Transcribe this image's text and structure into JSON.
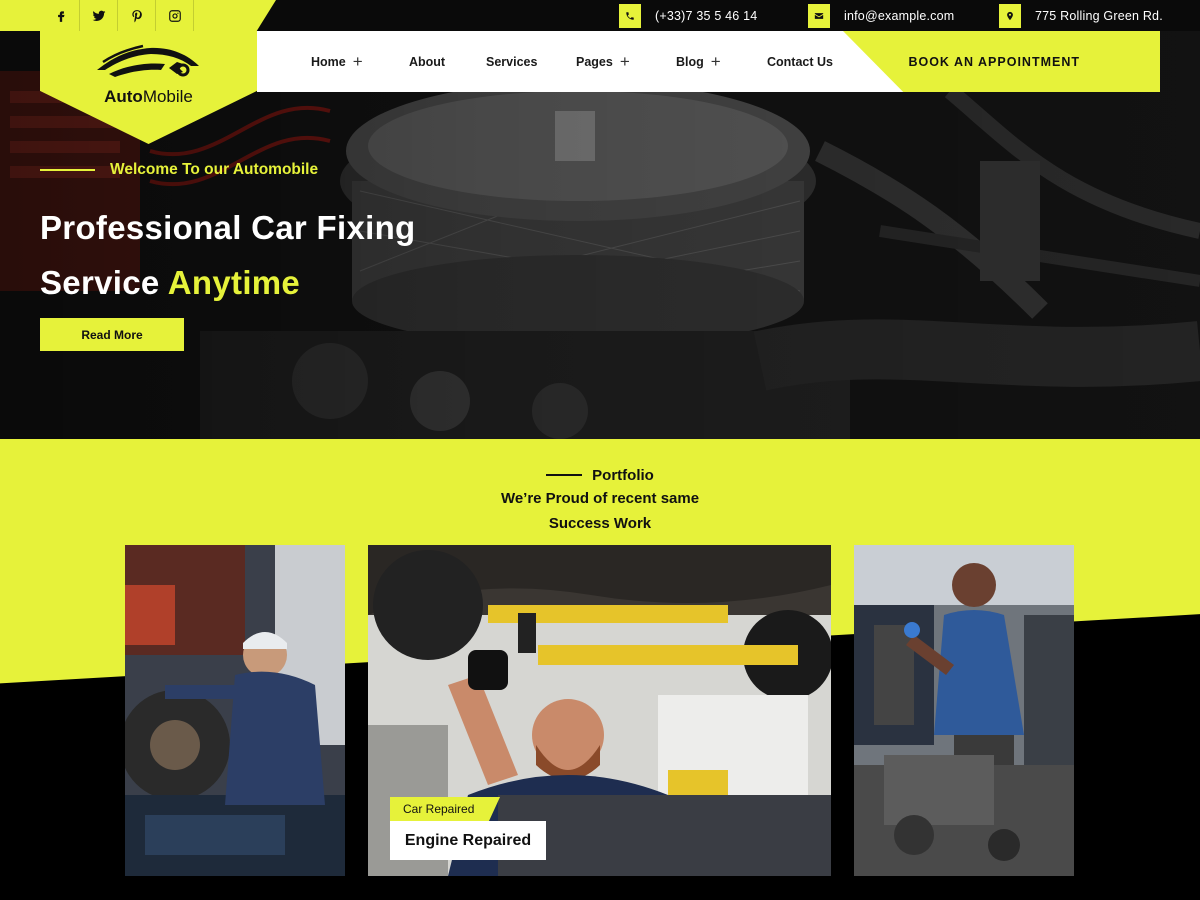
{
  "topbar": {
    "socials": [
      {
        "icon": "facebook-icon"
      },
      {
        "icon": "twitter-icon"
      },
      {
        "icon": "pinterest-icon"
      },
      {
        "icon": "instagram-icon"
      }
    ],
    "phone": "(+33)7 35 5 46 14",
    "email": "info@example.com",
    "address": "775 Rolling Green Rd."
  },
  "logo": {
    "bold": "Auto",
    "rest": "Mobile"
  },
  "nav": {
    "items": [
      {
        "label": "Home",
        "has_submenu": true
      },
      {
        "label": "About",
        "has_submenu": false
      },
      {
        "label": "Services",
        "has_submenu": false
      },
      {
        "label": "Pages",
        "has_submenu": true
      },
      {
        "label": "Blog",
        "has_submenu": true
      },
      {
        "label": "Contact Us",
        "has_submenu": false
      }
    ],
    "cta": "BOOK AN APPOINTMENT"
  },
  "hero": {
    "eyebrow": "Welcome To our Automobile",
    "title_line1": "Professional Car Fixing",
    "title_line2_plain": "Service ",
    "title_line2_accent": "Anytime",
    "button": "Read More"
  },
  "portfolio": {
    "tag": "Portfolio",
    "title_line1": "We’re Proud of recent same",
    "title_line2": "Success Work",
    "featured": {
      "badge": "Car Repaired",
      "title": "Engine Repaired"
    }
  },
  "colors": {
    "accent": "#e6f23a",
    "dark": "#0a0a0a",
    "white": "#ffffff"
  }
}
